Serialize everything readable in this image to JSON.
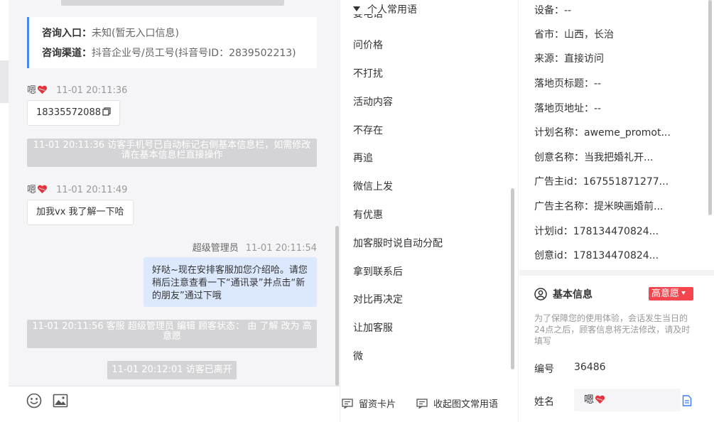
{
  "chat": {
    "info_card": {
      "entry_label": "咨询入口：",
      "entry_value": "未知(暂无入口信息)",
      "channel_label": "咨询渠道：",
      "channel_value": "抖音企业号/员工号(抖音号ID：2839502213)"
    },
    "messages": [
      {
        "sender": "嗯",
        "time": "11-01 20:11:36",
        "text": "18335572088"
      },
      {
        "system": "11-01 20:11:36 访客手机号已自动标记右侧基本信息栏，如需修改请在基本信息栏直接操作"
      },
      {
        "sender": "嗯",
        "time": "11-01 20:11:49",
        "text": "加我vx 我了解一下哈"
      },
      {
        "sender": "超级管理员",
        "time": "11-01 20:11:54",
        "text": "好哒~现在安排客服加您介绍哈。请您稍后注意查看一下“通讯录”并点击“新的朋友”通过下哦"
      },
      {
        "system": "11-01 20:11:56 客服 超级管理员 编辑 顾客状态： 由 了解 改为 高意愿"
      },
      {
        "system": "11-01 20:12:01 访客已离开"
      }
    ]
  },
  "phrases": {
    "header": "个人常用语",
    "peek": "要电话",
    "items": [
      "问价格",
      "不打扰",
      "活动内容",
      "不存在",
      "再追",
      "微信上发",
      "有优惠",
      "加客服时说自动分配",
      "拿到联系后",
      "对比再决定",
      "让加客服",
      "微"
    ],
    "footer": {
      "card_label": "留资卡片",
      "collapse_label": "收起图文常用语"
    }
  },
  "info": {
    "fields": [
      {
        "label": "设备：",
        "value": "--"
      },
      {
        "label": "省市：",
        "value": "山西，长治"
      },
      {
        "label": "来源：",
        "value": "直接访问"
      },
      {
        "label": "落地页标题：",
        "value": "--"
      },
      {
        "label": "落地页地址：",
        "value": "--"
      },
      {
        "label": "计划名称：",
        "value": "aweme_promot..."
      },
      {
        "label": "创意名称：",
        "value": "当我把婚礼开..."
      },
      {
        "label": "广告主id：",
        "value": "167551871277..."
      },
      {
        "label": "广告主名称：",
        "value": "提米映画婚前..."
      },
      {
        "label": "计划id：",
        "value": "178134470824..."
      },
      {
        "label": "创意id：",
        "value": "178134470824..."
      }
    ],
    "basic": {
      "title": "基本信息",
      "intent": "高意愿",
      "hint": "为了保障您的使用体验，会话发生当日的24点之后，顾客信息将无法修改，请及时填写",
      "id_label": "编号",
      "id_value": "36486",
      "name_label": "姓名",
      "name_value": "嗯"
    }
  },
  "colors": {
    "accent": "#4b86f5",
    "badge": "#f5454f",
    "my_bubble": "#dbe8fd",
    "system_bg": "#d4d4d6"
  }
}
